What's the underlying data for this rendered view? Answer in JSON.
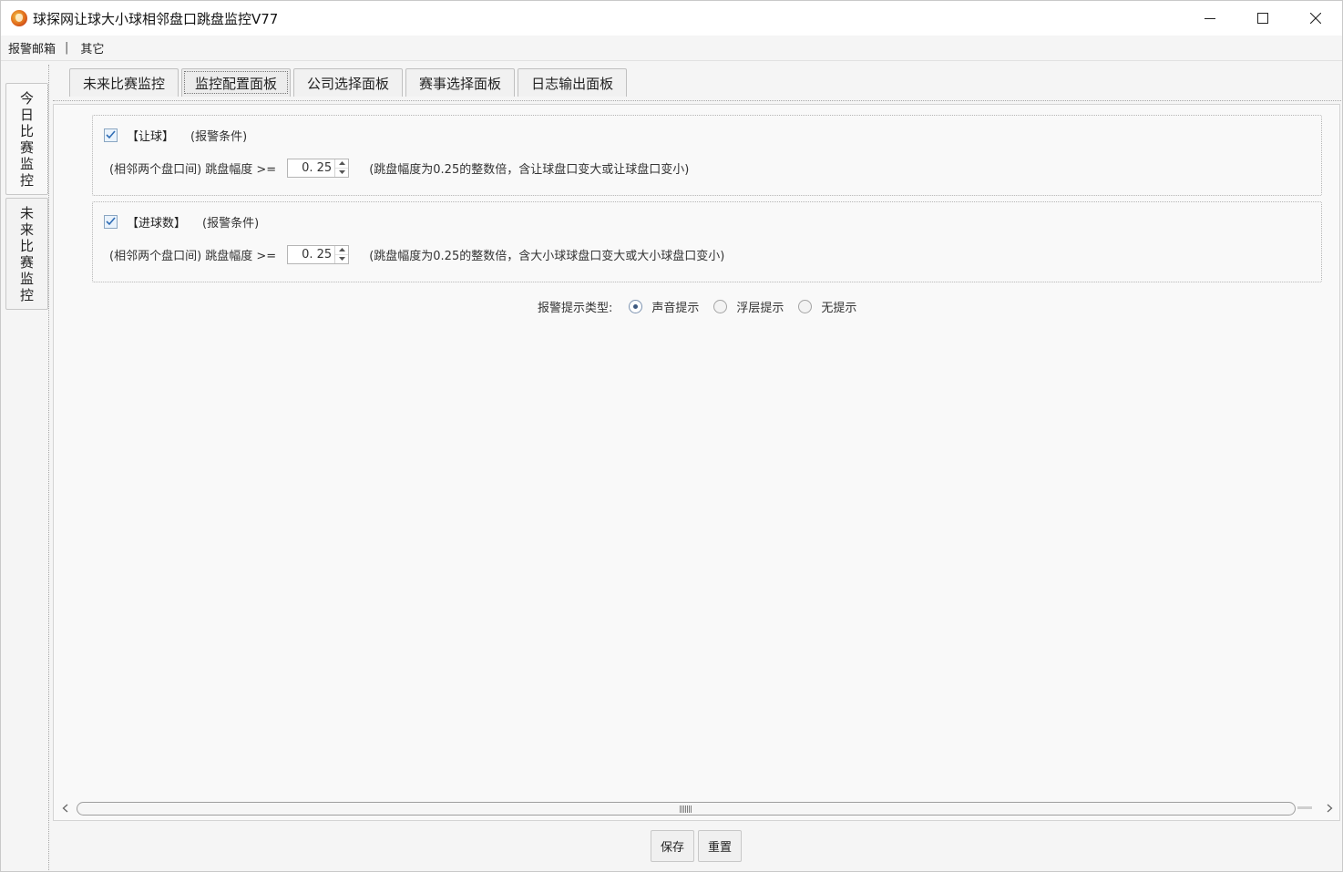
{
  "window": {
    "title": "球探网让球大小球相邻盘口跳盘监控V77"
  },
  "menu": {
    "items": [
      "报警邮箱",
      "其它"
    ],
    "separator": "|"
  },
  "vertical_tabs": [
    {
      "label": "今日比赛监控",
      "chars": [
        "今",
        "日",
        "比",
        "赛",
        "监",
        "控"
      ],
      "active": true
    },
    {
      "label": "未来比赛监控",
      "chars": [
        "未",
        "来",
        "比",
        "赛",
        "监",
        "控"
      ],
      "active": false
    }
  ],
  "tabs": [
    {
      "label": "未来比赛监控",
      "active": false
    },
    {
      "label": "监控配置面板",
      "active": true
    },
    {
      "label": "公司选择面板",
      "active": false
    },
    {
      "label": "赛事选择面板",
      "active": false
    },
    {
      "label": "日志输出面板",
      "active": false
    }
  ],
  "handicap_group": {
    "checked": true,
    "title": "【让球】",
    "condition": "(报警条件)",
    "prefix": "(相邻两个盘口间) 跳盘幅度 >=",
    "value": "0. 25",
    "hint": "(跳盘幅度为0.25的整数倍，含让球盘口变大或让球盘口变小)"
  },
  "goals_group": {
    "checked": true,
    "title": "【进球数】",
    "condition": "(报警条件)",
    "prefix": "(相邻两个盘口间) 跳盘幅度 >=",
    "value": "0. 25",
    "hint": "(跳盘幅度为0.25的整数倍，含大小球球盘口变大或大小球盘口变小)"
  },
  "alert_type": {
    "label": "报警提示类型:",
    "options": [
      {
        "label": "声音提示",
        "checked": true
      },
      {
        "label": "浮层提示",
        "checked": false
      },
      {
        "label": "无提示",
        "checked": false
      }
    ]
  },
  "buttons": {
    "save": "保存",
    "reset": "重置"
  },
  "colors": {
    "accent_red": "#e23b3b",
    "accent_blue": "#3e6ec9",
    "checkmark": "#2f6db5"
  }
}
